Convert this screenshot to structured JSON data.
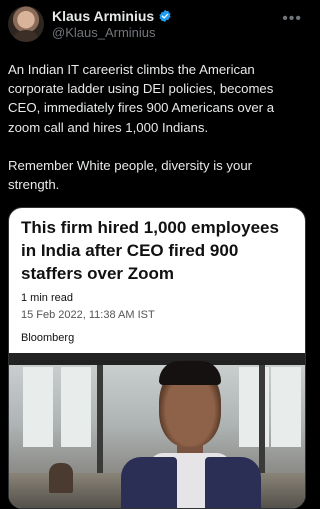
{
  "author": {
    "display_name": "Klaus Arminius",
    "handle": "@Klaus_Arminius"
  },
  "icons": {
    "verified": "verified-badge-icon",
    "more": "more-options-icon"
  },
  "colors": {
    "verified": "#1d9bf0",
    "background": "#000000",
    "text": "#e7e9ea",
    "muted": "#71767b"
  },
  "tweet": {
    "text": "An Indian IT careerist climbs the American corporate ladder using DEI policies, becomes CEO, immediately fires 900 Americans over a zoom call and hires 1,000 Indians.\n\nRemember White people, diversity is your strength."
  },
  "card": {
    "headline": "This firm hired 1,000 employees in India after CEO fired 900 staffers over Zoom",
    "read_time": "1 min read",
    "date": "15 Feb 2022, 11:38 AM IST",
    "source": "Bloomberg"
  }
}
